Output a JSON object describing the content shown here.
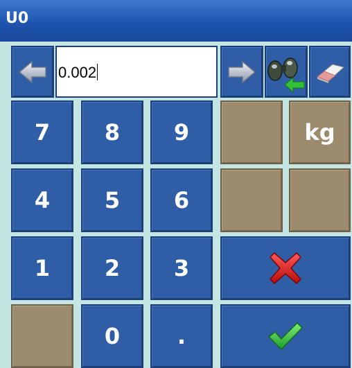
{
  "window": {
    "title": "U0"
  },
  "input": {
    "value": "0.002"
  },
  "keys": {
    "seven": "7",
    "eight": "8",
    "nine": "9",
    "four": "4",
    "five": "5",
    "six": "6",
    "one": "1",
    "two": "2",
    "three": "3",
    "zero": "0",
    "dot": ".",
    "unit": "kg"
  },
  "icons": {
    "left": "arrow-left-icon",
    "right": "arrow-right-icon",
    "find": "binoculars-icon",
    "clear": "eraser-icon",
    "cancel": "red-x-icon",
    "ok": "green-check-icon"
  },
  "colors": {
    "background": "#c3e6e3",
    "titlebar": "#1f55b0",
    "key_blue": "#2f5ea6",
    "key_tan": "#9c8b6d"
  }
}
